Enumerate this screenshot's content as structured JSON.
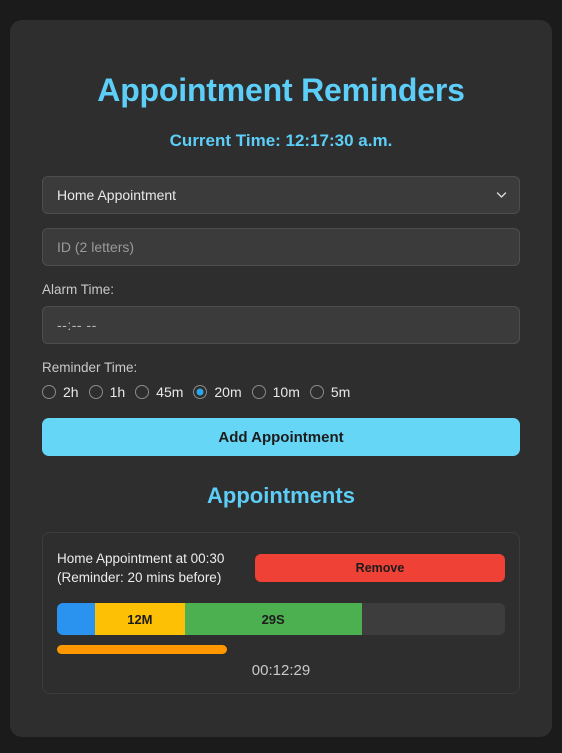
{
  "app": {
    "title": "Appointment Reminders",
    "current_time_label": "Current Time: 12:17:30 a.m.",
    "accent_color": "#5ccef7",
    "background_color": "#1b1b1b",
    "panel_color": "#2e2e2e"
  },
  "form": {
    "appointment_type": {
      "selected": "Home Appointment",
      "icon": "chevron-down-icon"
    },
    "id_field": {
      "value": "",
      "placeholder": "ID (2 letters)"
    },
    "alarm_time": {
      "label": "Alarm Time:",
      "value": "",
      "placeholder": "--:-- --"
    },
    "reminder_time": {
      "label": "Reminder Time:",
      "selected": "20m",
      "options": [
        {
          "label": "2h",
          "checked": false
        },
        {
          "label": "1h",
          "checked": false
        },
        {
          "label": "45m",
          "checked": false
        },
        {
          "label": "20m",
          "checked": true
        },
        {
          "label": "10m",
          "checked": false
        },
        {
          "label": "5m",
          "checked": false
        }
      ]
    },
    "add_button_label": "Add Appointment"
  },
  "appointments_section": {
    "title": "Appointments",
    "items": [
      {
        "line1": "Home Appointment at 00:30",
        "line2": "(Reminder: 20 mins before)",
        "remove_label": "Remove",
        "countdown_text": "00:12:29",
        "segments": [
          {
            "name": "days",
            "label": "",
            "color": "#2a93f0",
            "width_pct": 8.5
          },
          {
            "name": "hours",
            "label": "12M",
            "color": "#fdc004",
            "width_pct": 20.0
          },
          {
            "name": "minutes",
            "label": "29S",
            "color": "#4caf50",
            "width_pct": 39.5
          },
          {
            "name": "empty",
            "label": "",
            "color": "#3d3d3d",
            "width_pct": 32.0
          }
        ],
        "progress": {
          "percent": 38,
          "color": "#ff9800"
        }
      }
    ]
  }
}
